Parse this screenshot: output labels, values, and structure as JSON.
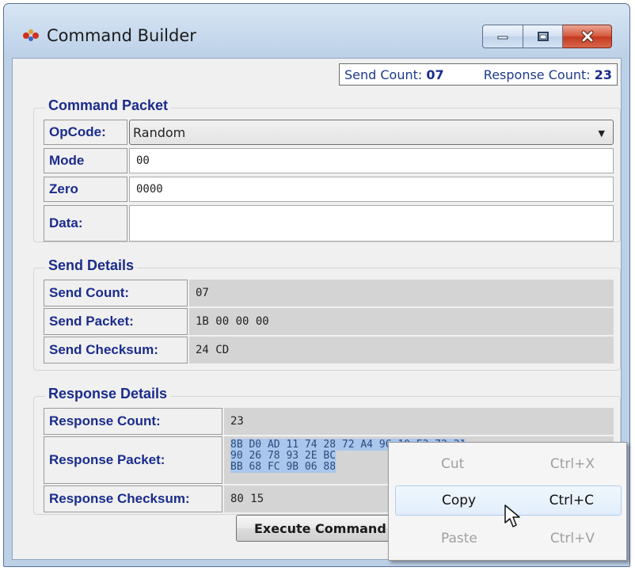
{
  "window": {
    "title": "Command Builder"
  },
  "counts": {
    "send_label": "Send Count:",
    "send_value": "07",
    "response_label": "Response Count:",
    "response_value": "23"
  },
  "command_packet": {
    "title": "Command Packet",
    "opcode_label": "OpCode:",
    "opcode_value": "Random",
    "mode_label": "Mode",
    "mode_value": "00",
    "zero_label": "Zero",
    "zero_value": "0000",
    "data_label": "Data:",
    "data_value": ""
  },
  "send_details": {
    "title": "Send Details",
    "count_label": "Send Count:",
    "count_value": "07",
    "packet_label": "Send Packet:",
    "packet_value": "1B 00 00 00",
    "checksum_label": "Send Checksum:",
    "checksum_value": "24 CD"
  },
  "response_details": {
    "title": "Response Details",
    "count_label": "Response Count:",
    "count_value": "23",
    "packet_label": "Response Packet:",
    "packet_lines": [
      "8B D0 AD 11 74 28 72 A4 9C 10 E3 72 31",
      "90 26 78 93 2E BC",
      "BB 68 FC 9B 06 88"
    ],
    "checksum_label": "Response Checksum:",
    "checksum_value": "80 15"
  },
  "execute_button": {
    "label": "Execute Command"
  },
  "context_menu": {
    "items": [
      {
        "label": "Cut",
        "shortcut": "Ctrl+X",
        "enabled": false
      },
      {
        "label": "Copy",
        "shortcut": "Ctrl+C",
        "enabled": true
      },
      {
        "label": "Paste",
        "shortcut": "Ctrl+V",
        "enabled": false
      }
    ]
  },
  "icons": {
    "app": "app-icon",
    "minimize": "minimize-icon",
    "maximize": "maximize-icon",
    "close": "close-icon",
    "dropdown": "chevron-down-icon",
    "cursor": "mouse-pointer-icon"
  },
  "colors": {
    "label_text": "#1a2c8c",
    "selection": "#a9c7ec",
    "close_button": "#c43a20"
  }
}
